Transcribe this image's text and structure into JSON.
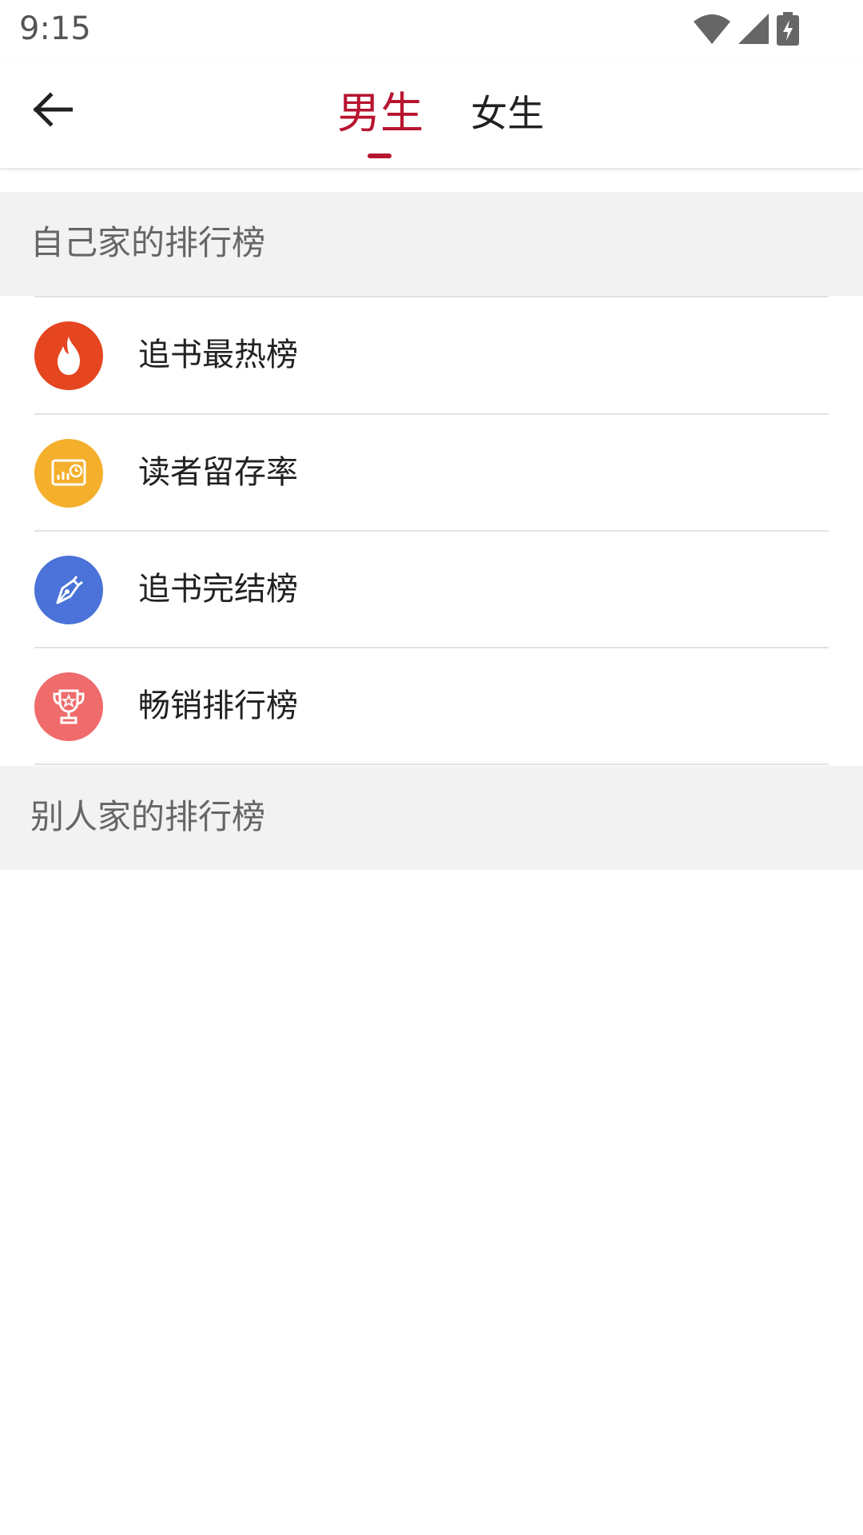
{
  "status_bar": {
    "time": "9:15",
    "icons": [
      "wifi-icon",
      "cellular-signal-icon",
      "battery-charging-icon"
    ]
  },
  "toolbar": {
    "back_icon": "arrow-left-icon",
    "tabs": [
      {
        "label": "男生",
        "selected": true
      },
      {
        "label": "女生",
        "selected": false
      }
    ],
    "accent_color": "#b71530"
  },
  "sections": {
    "own": {
      "title": "自己家的排行榜",
      "items": [
        {
          "label": "追书最热榜",
          "icon": "flame-icon",
          "color": "#e5451f"
        },
        {
          "label": "读者留存率",
          "icon": "chart-clock-icon",
          "color": "#f4af2d"
        },
        {
          "label": "追书完结榜",
          "icon": "pen-nib-icon",
          "color": "#4a72d8"
        },
        {
          "label": "畅销排行榜",
          "icon": "trophy-icon",
          "color": "#f06b6b"
        }
      ]
    },
    "others": {
      "title": "别人家的排行榜"
    }
  }
}
